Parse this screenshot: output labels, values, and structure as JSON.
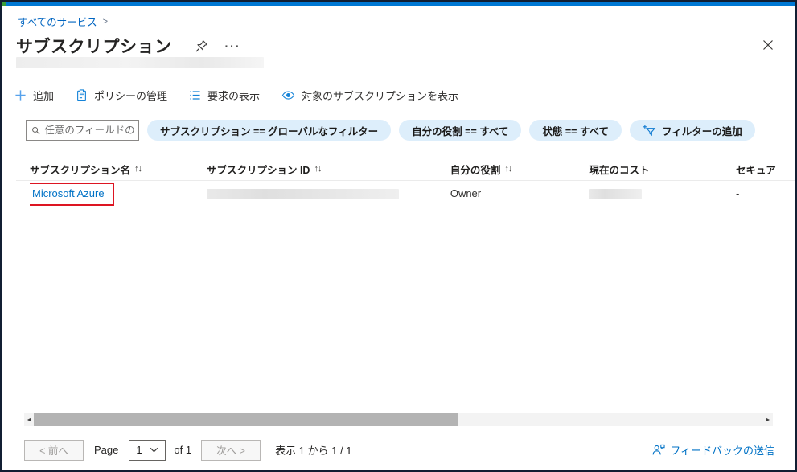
{
  "breadcrumb": {
    "all_services": "すべてのサービス",
    "chevron": ">"
  },
  "header": {
    "title": "サブスクリプション",
    "ellipsis": "···"
  },
  "toolbar": {
    "items": [
      {
        "label": "追加",
        "icon": "plus-icon"
      },
      {
        "label": "ポリシーの管理",
        "icon": "clipboard-icon"
      },
      {
        "label": "要求の表示",
        "icon": "list-icon"
      },
      {
        "label": "対象のサブスクリプションを表示",
        "icon": "eye-icon"
      }
    ]
  },
  "filters": {
    "search_placeholder": "任意のフィールドの...",
    "pills": [
      {
        "label": "サブスクリプション == グローバルなフィルター"
      },
      {
        "label": "自分の役割 == すべて"
      },
      {
        "label": "状態 == すべて"
      }
    ],
    "add_filter_label": "フィルターの追加"
  },
  "table": {
    "sort_glyph": "↑↓",
    "columns": [
      {
        "label": "サブスクリプション名"
      },
      {
        "label": "サブスクリプション ID"
      },
      {
        "label": "自分の役割"
      },
      {
        "label": "現在のコスト"
      },
      {
        "label": "セキュア"
      }
    ],
    "row": {
      "name": "Microsoft Azure",
      "role": "Owner",
      "secure_score": "-"
    }
  },
  "pagination": {
    "prev_label": "< 前へ",
    "page_label": "Page",
    "page_value": "1",
    "of_label": "of 1",
    "next_label": "次へ >",
    "summary": "表示 1 から 1 / 1"
  },
  "feedback_label": "フィードバックの送信",
  "colors": {
    "accent": "#0078d4",
    "link": "#0072c6",
    "annotation_red": "#dd1522",
    "pill_background": "#ddeefb"
  }
}
